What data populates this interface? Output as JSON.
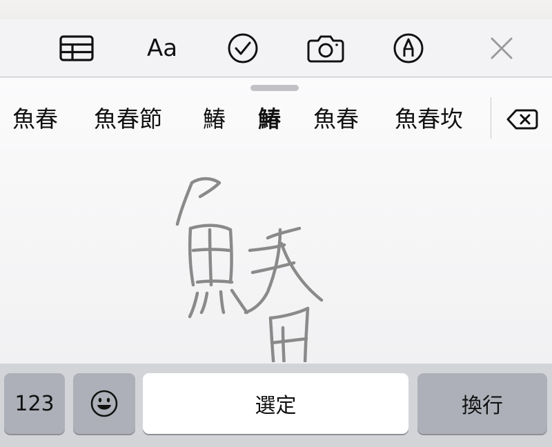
{
  "toolbar": {
    "items": [
      {
        "name": "table-icon"
      },
      {
        "name": "format-text-button",
        "label": "Aa"
      },
      {
        "name": "checklist-icon"
      },
      {
        "name": "camera-icon"
      },
      {
        "name": "markup-pen-icon"
      },
      {
        "name": "close-icon"
      }
    ],
    "format_label": "Aa"
  },
  "candidates": [
    "魚春",
    "魚春節",
    "鰆",
    "鰆",
    "魚春",
    "魚春坎"
  ],
  "handwriting": {
    "ink_color": "#8a8a8a"
  },
  "bottom_row": {
    "numbers_label": "123",
    "space_label": "選定",
    "return_label": "換行"
  },
  "colors": {
    "toolbar_bg": "#f3f3f6",
    "key_gray": "#adb0b8",
    "key_white": "#ffffff",
    "row_bg": "#d3d4d8"
  }
}
